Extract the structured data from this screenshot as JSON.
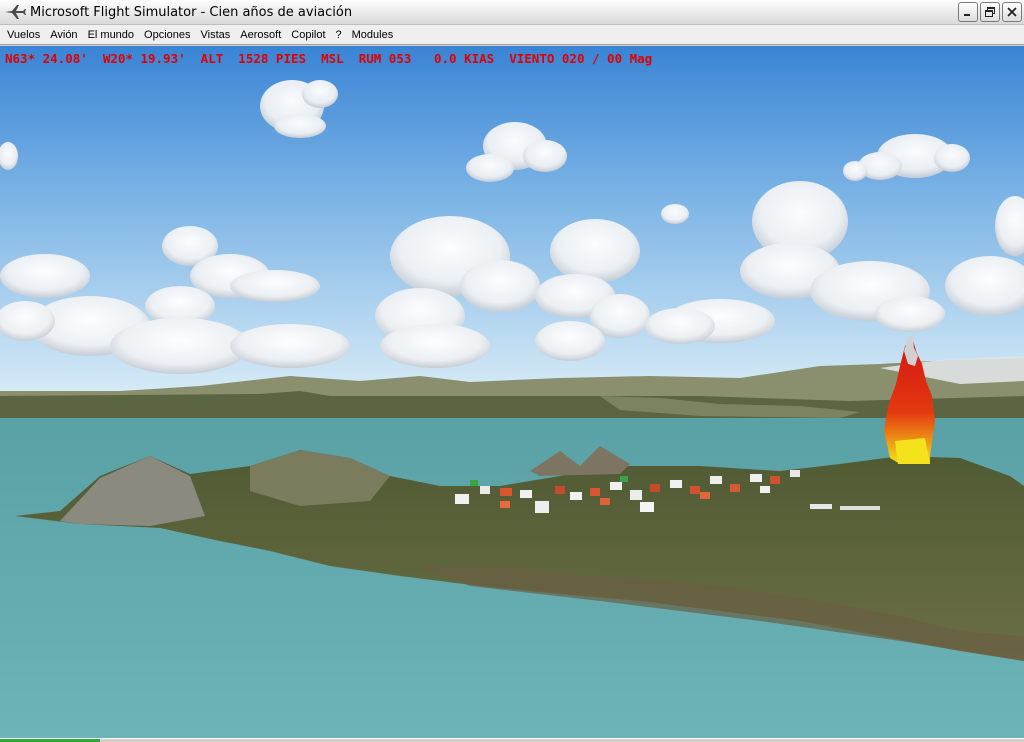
{
  "window": {
    "title": "Microsoft Flight Simulator - Cien años de aviación",
    "icon": "airplane-icon"
  },
  "menu": {
    "items": [
      {
        "label": "Vuelos",
        "key": "vuelos"
      },
      {
        "label": "Avión",
        "key": "avion"
      },
      {
        "label": "El mundo",
        "key": "el-mundo"
      },
      {
        "label": "Opciones",
        "key": "opciones"
      },
      {
        "label": "Vistas",
        "key": "vistas"
      },
      {
        "label": "Aerosoft",
        "key": "aerosoft"
      },
      {
        "label": "Copilot",
        "key": "copilot"
      },
      {
        "label": "?",
        "key": "help"
      },
      {
        "label": "Modules",
        "key": "modules"
      }
    ]
  },
  "hud": {
    "text": "N63* 24.08'  W20* 19.93'  ALT  1528 PIES  MSL  RUM 053   0.0 KIAS  VIENTO 020 / 00 Mag",
    "color": "#e10000"
  },
  "scene": {
    "sky_top": "#3f86d6",
    "sky_bottom": "#cfe6f6",
    "water": "#6bb0b3",
    "land": "#5e6a3e",
    "fire": "#e52a12"
  }
}
